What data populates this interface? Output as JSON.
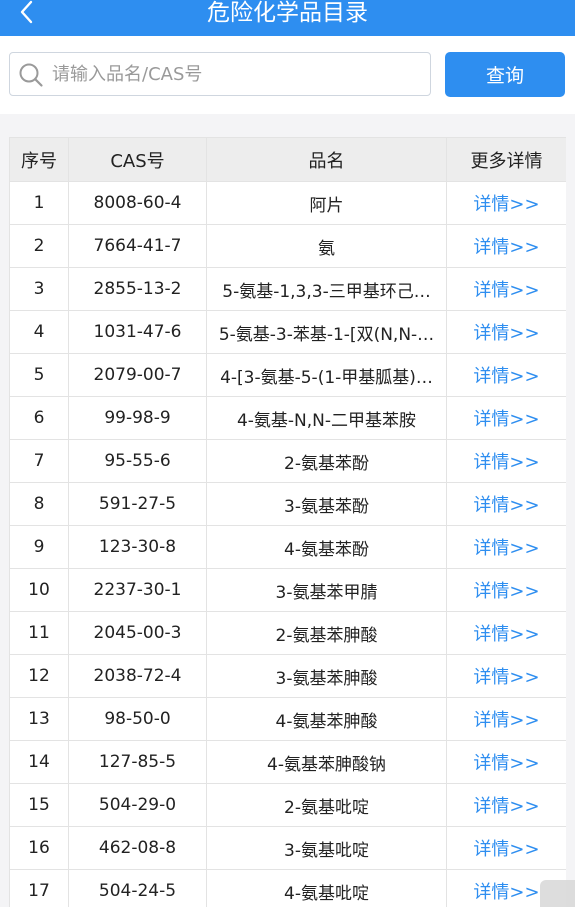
{
  "header": {
    "title": "危险化学品目录"
  },
  "search": {
    "placeholder": "请输入品名/CAS号",
    "value": "",
    "button_label": "查询"
  },
  "table": {
    "columns": [
      "序号",
      "CAS号",
      "品名",
      "更多详情"
    ],
    "detail_label": "详情>>",
    "rows": [
      {
        "no": "1",
        "cas": "8008-60-4",
        "name": "阿片"
      },
      {
        "no": "2",
        "cas": "7664-41-7",
        "name": "氨"
      },
      {
        "no": "3",
        "cas": "2855-13-2",
        "name": "5-氨基-1,3,3-三甲基环己…"
      },
      {
        "no": "4",
        "cas": "1031-47-6",
        "name": "5-氨基-3-苯基-1-[双(N,N-…"
      },
      {
        "no": "5",
        "cas": "2079-00-7",
        "name": "4-[3-氨基-5-(1-甲基胍基)…"
      },
      {
        "no": "6",
        "cas": "99-98-9",
        "name": "4-氨基-N,N-二甲基苯胺"
      },
      {
        "no": "7",
        "cas": "95-55-6",
        "name": "2-氨基苯酚"
      },
      {
        "no": "8",
        "cas": "591-27-5",
        "name": "3-氨基苯酚"
      },
      {
        "no": "9",
        "cas": "123-30-8",
        "name": "4-氨基苯酚"
      },
      {
        "no": "10",
        "cas": "2237-30-1",
        "name": "3-氨基苯甲腈"
      },
      {
        "no": "11",
        "cas": "2045-00-3",
        "name": "2-氨基苯胂酸"
      },
      {
        "no": "12",
        "cas": "2038-72-4",
        "name": "3-氨基苯胂酸"
      },
      {
        "no": "13",
        "cas": "98-50-0",
        "name": "4-氨基苯胂酸"
      },
      {
        "no": "14",
        "cas": "127-85-5",
        "name": "4-氨基苯胂酸钠"
      },
      {
        "no": "15",
        "cas": "504-29-0",
        "name": "2-氨基吡啶"
      },
      {
        "no": "16",
        "cas": "462-08-8",
        "name": "3-氨基吡啶"
      },
      {
        "no": "17",
        "cas": "504-24-5",
        "name": "4-氨基吡啶"
      }
    ]
  },
  "colors": {
    "accent": "#2e8ef0",
    "header_bg": "#2e8ef0",
    "table_header_bg": "#ededed",
    "link": "#2e8ef0"
  }
}
